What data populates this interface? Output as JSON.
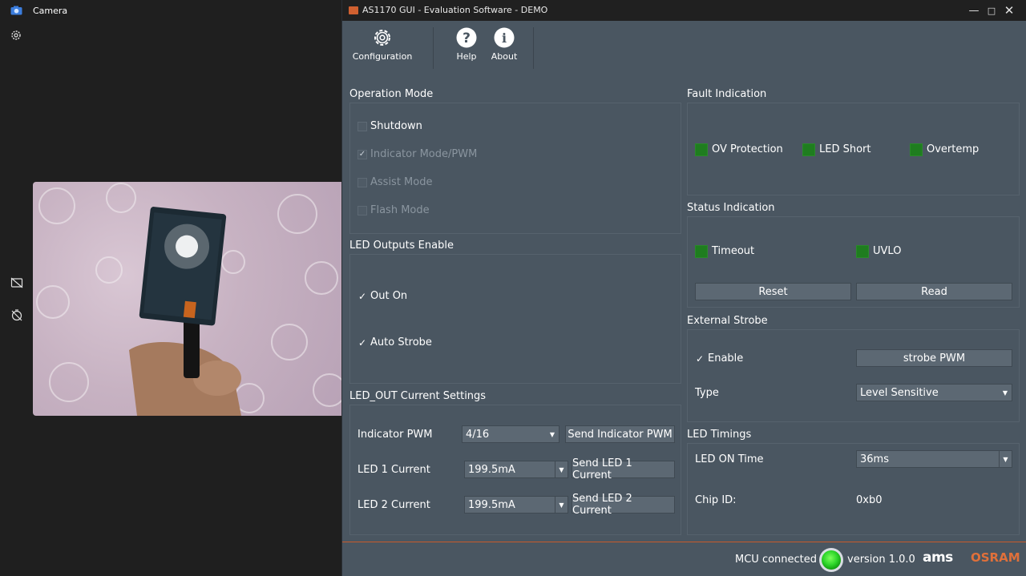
{
  "camera": {
    "title": "Camera"
  },
  "app": {
    "title": "AS1170 GUI - Evaluation Software - DEMO",
    "toolbar": {
      "configuration": "Configuration",
      "help": "Help",
      "about": "About"
    },
    "operation_mode": {
      "title": "Operation Mode",
      "options": [
        "Shutdown",
        "Indicator Mode/PWM",
        "Assist Mode",
        "Flash Mode"
      ]
    },
    "led_outputs": {
      "title": "LED Outputs Enable",
      "out_on": "Out On",
      "auto_strobe": "Auto Strobe"
    },
    "led_out_current": {
      "title": "LED_OUT Current Settings",
      "indicator_pwm_label": "Indicator PWM",
      "indicator_pwm_value": "4/16",
      "send_indicator_pwm": "Send Indicator PWM",
      "led1_label": "LED 1 Current",
      "led1_value": "199.5mA",
      "send_led1": "Send LED 1 Current",
      "led2_label": "LED 2 Current",
      "led2_value": "199.5mA",
      "send_led2": "Send LED 2 Current"
    },
    "fault": {
      "title": "Fault Indication",
      "ov": "OV Protection",
      "led_short": "LED Short",
      "overtemp": "Overtemp"
    },
    "status": {
      "title": "Status Indication",
      "timeout": "Timeout",
      "uvlo": "UVLO",
      "reset": "Reset",
      "read": "Read"
    },
    "external_strobe": {
      "title": "External Strobe",
      "enable": "Enable",
      "strobe_pwm": "strobe PWM",
      "type_label": "Type",
      "type_value": "Level Sensitive"
    },
    "led_timings": {
      "title": "LED Timings",
      "on_time_label": "LED ON Time",
      "on_time_value": "36ms",
      "chip_id_label": "Chip ID:",
      "chip_id_value": "0xb0"
    },
    "statusbar": {
      "mcu": "MCU connected",
      "version": "version 1.0.0",
      "brand1": "ams",
      "brand2": "OSRAM"
    }
  }
}
